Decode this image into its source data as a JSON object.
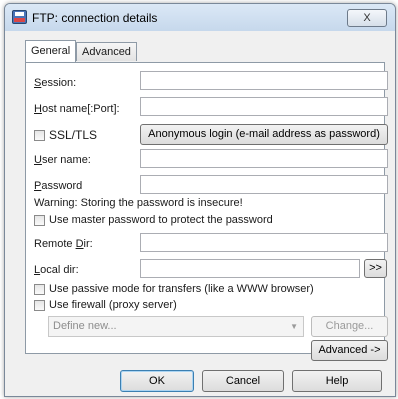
{
  "window": {
    "title": "FTP: connection details",
    "close_label": "X"
  },
  "tabs": [
    {
      "label": "General",
      "active": true
    },
    {
      "label": "Advanced",
      "active": false
    }
  ],
  "form": {
    "session": {
      "label_u": "S",
      "label_rest": "ession:",
      "value": ""
    },
    "host": {
      "label_u": "H",
      "label_rest": "ost name[:Port]:",
      "value": ""
    },
    "ssl": {
      "label": "SSL/TLS",
      "checked": false
    },
    "anonymous_button": "Anonymous login (e-mail address as password)",
    "user": {
      "label_u": "U",
      "label_rest": "ser name:",
      "value": ""
    },
    "password": {
      "label_u": "P",
      "label_rest": "assword",
      "value": ""
    },
    "warning": "Warning: Storing the password is insecure!",
    "master_password": {
      "label": "Use master password to protect the password",
      "checked": false
    },
    "remote_dir": {
      "label_pre": "Remote ",
      "label_u": "D",
      "label_rest": "ir:",
      "value": ""
    },
    "local_dir": {
      "label_u": "L",
      "label_rest": "ocal dir:",
      "value": ""
    },
    "browse_button": ">>",
    "passive_mode": {
      "label": "Use passive mode for transfers (like a WWW browser)",
      "checked": false
    },
    "firewall": {
      "label": "Use firewall (proxy server)",
      "checked": false
    },
    "proxy_select": {
      "value": "Define new...",
      "arrow": "▼"
    },
    "change_button": "Change...",
    "advanced_button": "Advanced ->"
  },
  "footer": {
    "ok": "OK",
    "cancel": "Cancel",
    "help": "Help"
  }
}
